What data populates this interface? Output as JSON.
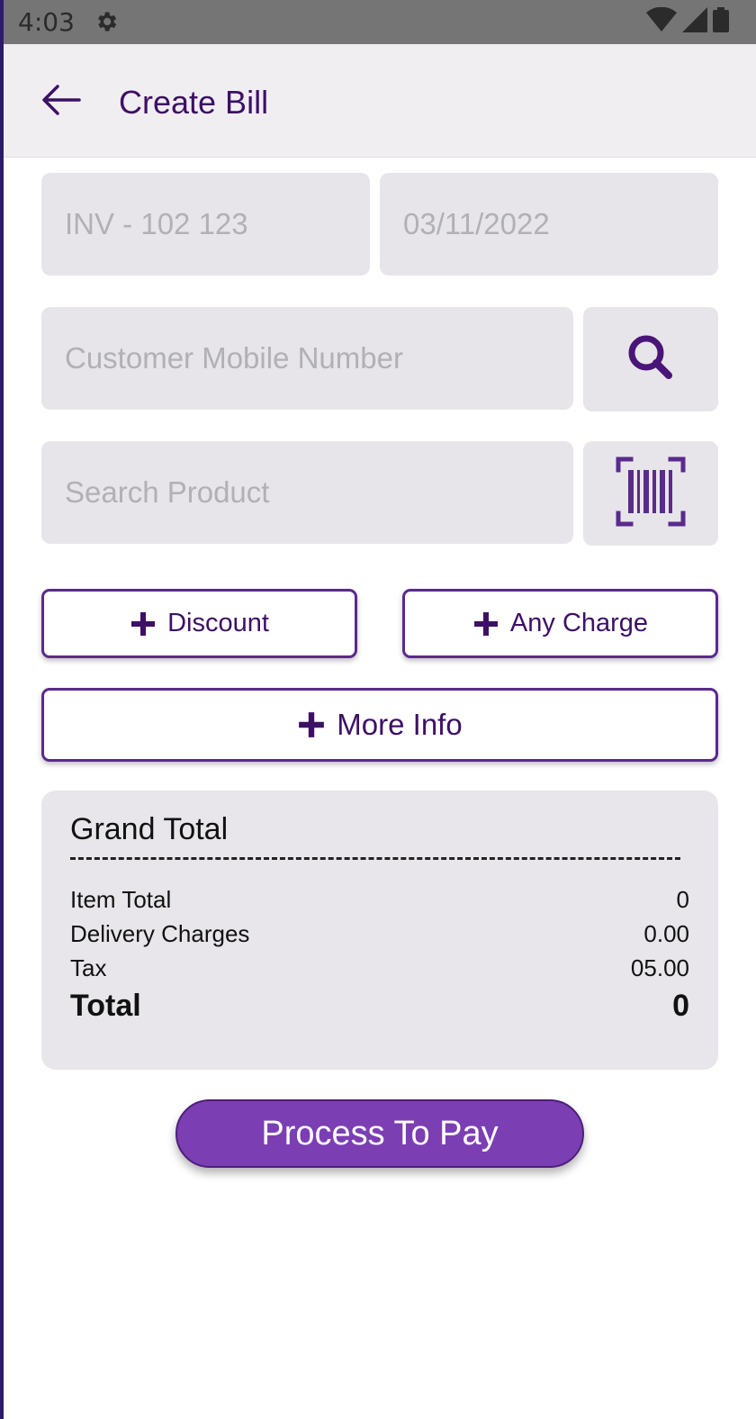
{
  "status_bar": {
    "time": "4:03",
    "icons": [
      "settings-icon",
      "wifi-icon",
      "signal-icon",
      "battery-icon"
    ]
  },
  "app_bar": {
    "title": "Create Bill",
    "back_icon": "arrow-back-icon"
  },
  "form": {
    "invoice_placeholder": "INV - 102 123",
    "date_placeholder": "03/11/2022",
    "mobile_placeholder": "Customer Mobile Number",
    "product_placeholder": "Search Product",
    "search_icon": "search-icon",
    "barcode_icon": "barcode-scan-icon"
  },
  "actions": {
    "discount_label": "Discount",
    "any_charge_label": "Any Charge",
    "more_info_label": "More Info"
  },
  "summary": {
    "title": "Grand Total",
    "rows": [
      {
        "label": "Item Total",
        "value": "0"
      },
      {
        "label": "Delivery Charges",
        "value": "0.00"
      },
      {
        "label": "Tax",
        "value": "05.00"
      }
    ],
    "total_label": "Total",
    "total_value": "0"
  },
  "pay_button_label": "Process To Pay",
  "colors": {
    "primary": "#3d1065",
    "accent": "#7b3fb3",
    "field_bg": "#e7e5ea",
    "appbar_bg": "#f1eef2"
  }
}
